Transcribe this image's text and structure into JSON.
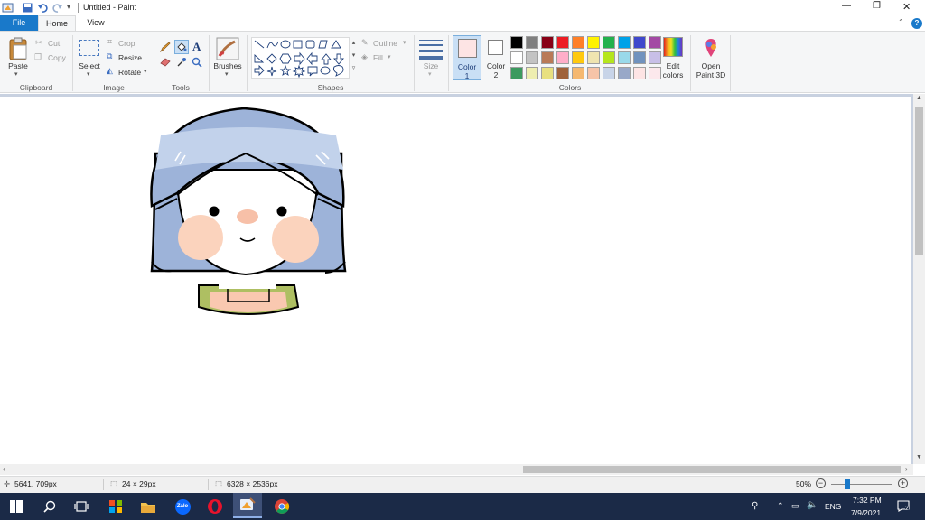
{
  "title_bar": {
    "title": "Untitled - Paint",
    "controls": [
      "—",
      "❐",
      "✕"
    ]
  },
  "menu": {
    "file": "File",
    "home": "Home",
    "view": "View"
  },
  "ribbon": {
    "clipboard": {
      "group": "Clipboard",
      "paste": "Paste",
      "cut": "Cut",
      "copy": "Copy"
    },
    "image": {
      "group": "Image",
      "select": "Select",
      "crop": "Crop",
      "resize": "Resize",
      "rotate": "Rotate"
    },
    "tools": {
      "group": "Tools"
    },
    "brushes": {
      "label": "Brushes"
    },
    "shapes": {
      "group": "Shapes",
      "outline": "Outline",
      "fill": "Fill"
    },
    "size": {
      "label": "Size"
    },
    "colors": {
      "group": "Colors",
      "color1": "Color",
      "color1_num": "1",
      "color2": "Color",
      "color2_num": "2",
      "edit": "Edit",
      "edit2": "colors",
      "color1_value": "#fde4e4",
      "color2_value": "#ffffff",
      "palette": [
        [
          "#000000",
          "#7f7f7f",
          "#880015",
          "#ed1c24",
          "#ff7f27",
          "#fff200",
          "#22b14c",
          "#00a2e8",
          "#3f48cc",
          "#a349a4"
        ],
        [
          "#ffffff",
          "#c3c3c3",
          "#b97a57",
          "#ffaec9",
          "#ffc90e",
          "#efe4b0",
          "#b5e61d",
          "#99d9ea",
          "#7092be",
          "#c8bfe7"
        ],
        [
          "#3c9a5f",
          "#eeeeb0",
          "#e8e080",
          "#a0623a",
          "#f5b870",
          "#f7c4a8",
          "#c8d4e8",
          "#98a8c8",
          "#fde4e4",
          "#fce8ec"
        ]
      ]
    },
    "paint3d": {
      "line1": "Open",
      "line2": "Paint 3D"
    }
  },
  "status": {
    "cursor": "5641, 709px",
    "selection": "24 × 29px",
    "image_size": "6328 × 2536px",
    "zoom": "50%"
  },
  "taskbar": {
    "ime": "ENG",
    "time": "7:32 PM",
    "date": "7/9/2021",
    "notification_count": "2"
  }
}
